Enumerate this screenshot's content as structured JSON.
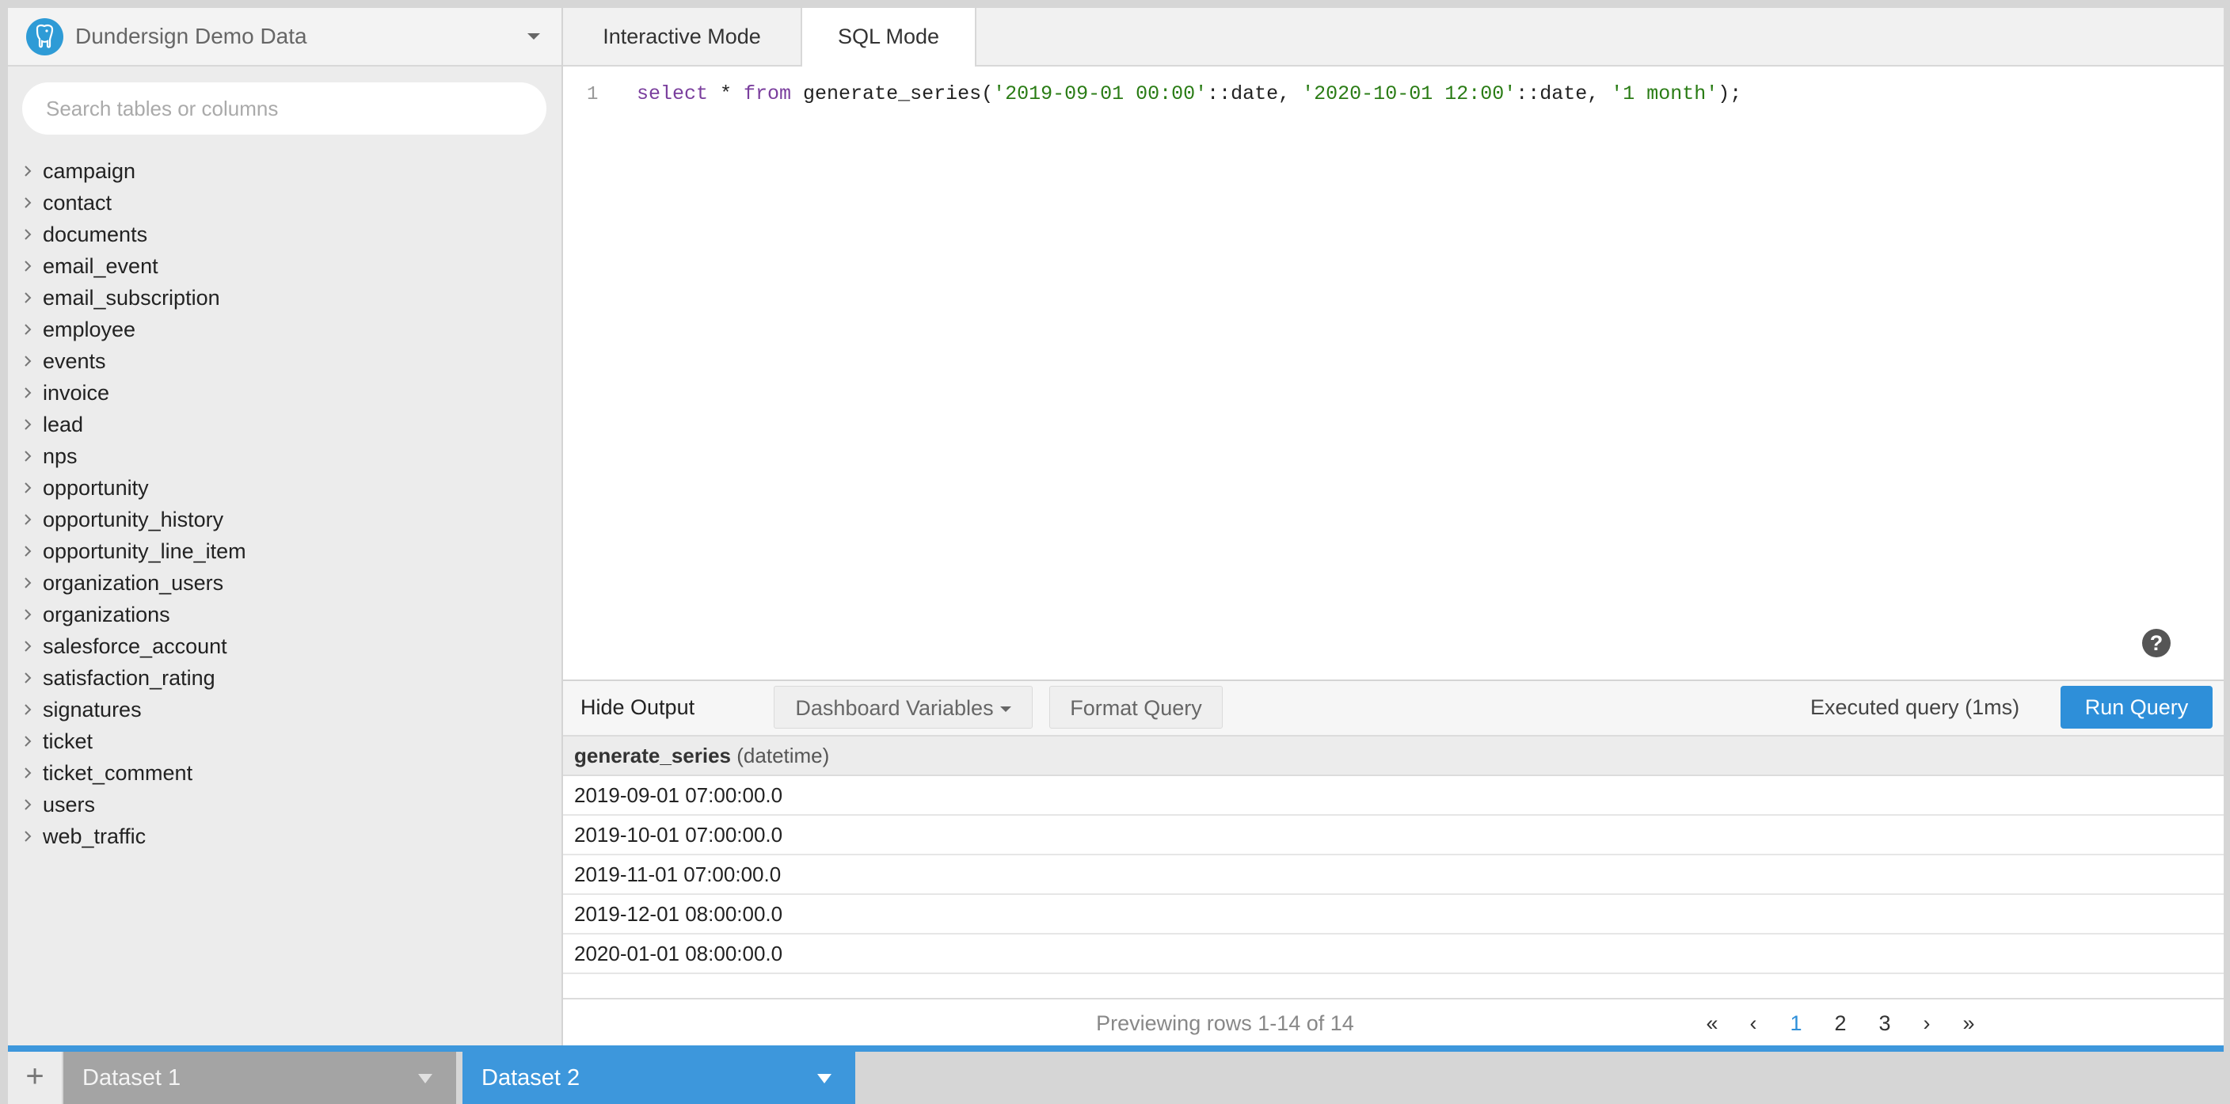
{
  "database": {
    "name": "Dundersign Demo Data",
    "icon": "postgres-elephant-icon"
  },
  "sidebar": {
    "search_placeholder": "Search tables or columns",
    "tables": [
      "campaign",
      "contact",
      "documents",
      "email_event",
      "email_subscription",
      "employee",
      "events",
      "invoice",
      "lead",
      "nps",
      "opportunity",
      "opportunity_history",
      "opportunity_line_item",
      "organization_users",
      "organizations",
      "salesforce_account",
      "satisfaction_rating",
      "signatures",
      "ticket",
      "ticket_comment",
      "users",
      "web_traffic"
    ]
  },
  "tabs": {
    "interactive": "Interactive Mode",
    "sql": "SQL Mode",
    "active": "sql"
  },
  "editor": {
    "line_number": "1",
    "code": "select * from generate_series('2019-09-01 00:00'::date, '2020-10-01 12:00'::date, '1 month');",
    "help": "?"
  },
  "toolbar": {
    "hide_output": "Hide Output",
    "dashboard_variables": "Dashboard Variables",
    "format_query": "Format Query",
    "status": "Executed query (1ms)",
    "run_query": "Run Query"
  },
  "results": {
    "column": {
      "name": "generate_series",
      "type": "(datetime)"
    },
    "rows": [
      "2019-09-01 07:00:00.0",
      "2019-10-01 07:00:00.0",
      "2019-11-01 07:00:00.0",
      "2019-12-01 08:00:00.0",
      "2020-01-01 08:00:00.0"
    ]
  },
  "pagination": {
    "preview": "Previewing rows 1-14 of 14",
    "first": "«",
    "prev": "‹",
    "pages": [
      "1",
      "2",
      "3"
    ],
    "current": "1",
    "next": "›",
    "last": "»"
  },
  "datasets": {
    "add_label": "+",
    "tabs": [
      {
        "label": "Dataset 1"
      },
      {
        "label": "Dataset 2"
      }
    ],
    "active": "Dataset 2"
  },
  "colors": {
    "accent": "#2e8fd9",
    "dataset_bar": "#3d97dc",
    "keyword": "#7a3e9d",
    "string": "#2a7c15"
  }
}
